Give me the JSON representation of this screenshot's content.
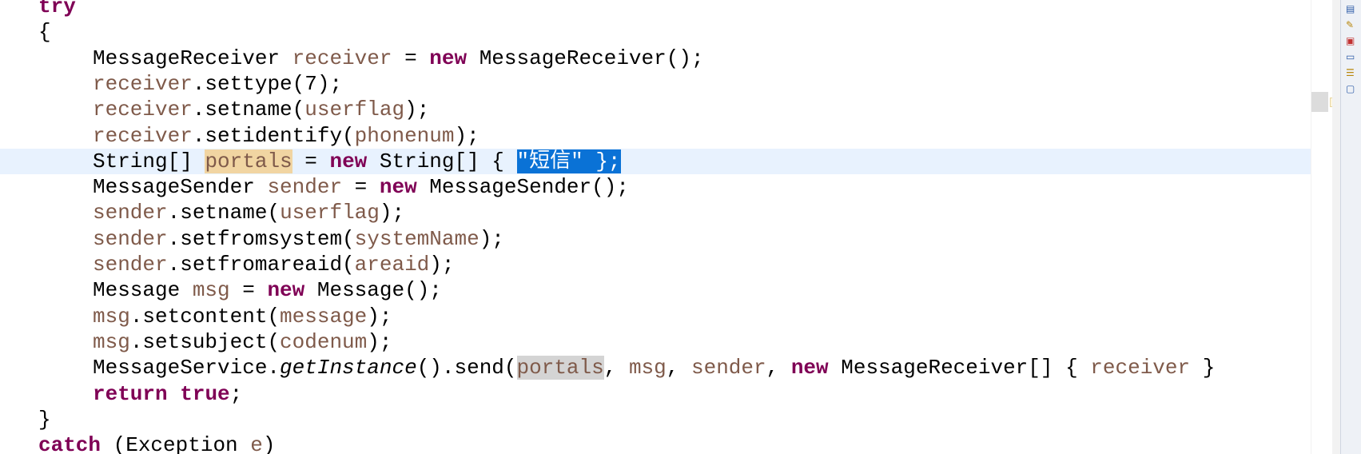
{
  "editor": {
    "current_line_index": 6,
    "lines": [
      [
        {
          "t": "try",
          "c": "kw"
        }
      ],
      [
        {
          "t": "{"
        }
      ],
      [
        {
          "t": "MessageReceiver "
        },
        {
          "t": "receiver",
          "c": "fld"
        },
        {
          "t": " = "
        },
        {
          "t": "new",
          "c": "kw"
        },
        {
          "t": " MessageReceiver();"
        }
      ],
      [
        {
          "t": "receiver",
          "c": "fld"
        },
        {
          "t": ".settype(7);"
        }
      ],
      [
        {
          "t": "receiver",
          "c": "fld"
        },
        {
          "t": ".setname("
        },
        {
          "t": "userflag",
          "c": "fld"
        },
        {
          "t": ");"
        }
      ],
      [
        {
          "t": "receiver",
          "c": "fld"
        },
        {
          "t": ".setidentify("
        },
        {
          "t": "phonenum",
          "c": "fld"
        },
        {
          "t": ");"
        }
      ],
      [
        {
          "t": "String[] "
        },
        {
          "t": "portals",
          "c": "fld occ-write"
        },
        {
          "t": " = "
        },
        {
          "t": "new",
          "c": "kw"
        },
        {
          "t": " String[] { "
        },
        {
          "t": "\"短信\" };",
          "c": "sel"
        }
      ],
      [
        {
          "t": "MessageSender "
        },
        {
          "t": "sender",
          "c": "fld"
        },
        {
          "t": " = "
        },
        {
          "t": "new",
          "c": "kw"
        },
        {
          "t": " MessageSender();"
        }
      ],
      [
        {
          "t": "sender",
          "c": "fld"
        },
        {
          "t": ".setname("
        },
        {
          "t": "userflag",
          "c": "fld"
        },
        {
          "t": ");"
        }
      ],
      [
        {
          "t": "sender",
          "c": "fld"
        },
        {
          "t": ".setfromsystem("
        },
        {
          "t": "systemName",
          "c": "fld"
        },
        {
          "t": ");"
        }
      ],
      [
        {
          "t": "sender",
          "c": "fld"
        },
        {
          "t": ".setfromareaid("
        },
        {
          "t": "areaid",
          "c": "fld"
        },
        {
          "t": ");"
        }
      ],
      [
        {
          "t": "Message "
        },
        {
          "t": "msg",
          "c": "fld"
        },
        {
          "t": " = "
        },
        {
          "t": "new",
          "c": "kw"
        },
        {
          "t": " Message();"
        }
      ],
      [
        {
          "t": "msg",
          "c": "fld"
        },
        {
          "t": ".setcontent("
        },
        {
          "t": "message",
          "c": "fld"
        },
        {
          "t": ");"
        }
      ],
      [
        {
          "t": "msg",
          "c": "fld"
        },
        {
          "t": ".setsubject("
        },
        {
          "t": "codenum",
          "c": "fld"
        },
        {
          "t": ");"
        }
      ],
      [
        {
          "t": "MessageService."
        },
        {
          "t": "getInstance",
          "c": "it"
        },
        {
          "t": "().send("
        },
        {
          "t": "portals",
          "c": "fld occ-read"
        },
        {
          "t": ", "
        },
        {
          "t": "msg",
          "c": "fld"
        },
        {
          "t": ", "
        },
        {
          "t": "sender",
          "c": "fld"
        },
        {
          "t": ", "
        },
        {
          "t": "new",
          "c": "kw"
        },
        {
          "t": " MessageReceiver[] { "
        },
        {
          "t": "receiver",
          "c": "fld"
        },
        {
          "t": " }"
        }
      ],
      [
        {
          "t": "return",
          "c": "kw"
        },
        {
          "t": " "
        },
        {
          "t": "true",
          "c": "kw"
        },
        {
          "t": ";"
        }
      ],
      [
        {
          "t": "}"
        }
      ],
      [
        {
          "t": "catch",
          "c": "kw"
        },
        {
          "t": " (Exception "
        },
        {
          "t": "e",
          "c": "fld"
        },
        {
          "t": ")"
        }
      ]
    ]
  },
  "side_icons": [
    "outline-icon",
    "pin-icon",
    "error-log-icon",
    "console-icon",
    "task-list-icon",
    "monitor-icon"
  ]
}
